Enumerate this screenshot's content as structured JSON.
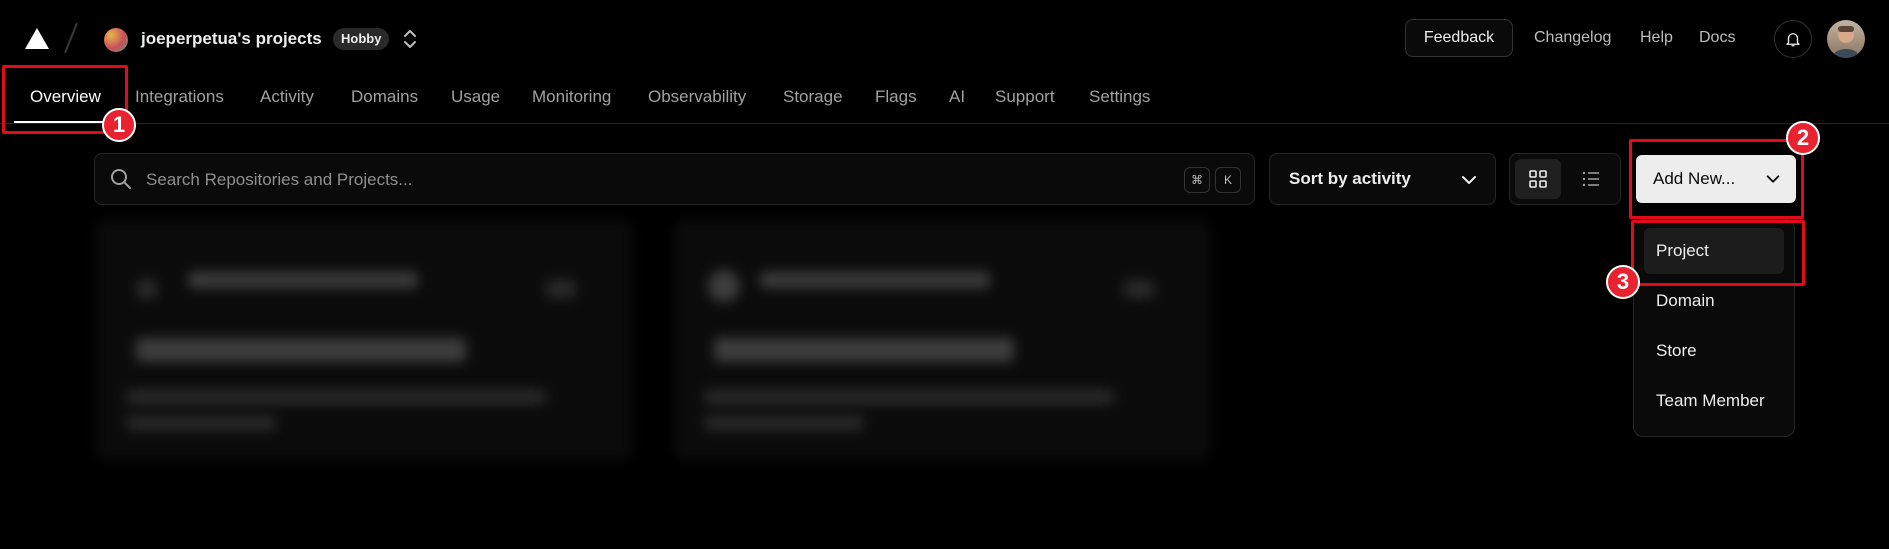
{
  "header": {
    "team_name": "joeperpetua's projects",
    "plan_badge": "Hobby",
    "feedback_label": "Feedback",
    "links": [
      "Changelog",
      "Help",
      "Docs"
    ]
  },
  "tabs": [
    "Overview",
    "Integrations",
    "Activity",
    "Domains",
    "Usage",
    "Monitoring",
    "Observability",
    "Storage",
    "Flags",
    "AI",
    "Support",
    "Settings"
  ],
  "active_tab": "Overview",
  "search": {
    "placeholder": "Search Repositories and Projects...",
    "value": "",
    "shortcut_keys": [
      "⌘",
      "K"
    ]
  },
  "sort": {
    "label": "Sort by activity"
  },
  "view": {
    "active": "grid"
  },
  "add_new": {
    "label": "Add New...",
    "menu_items": [
      "Project",
      "Domain",
      "Store",
      "Team Member"
    ],
    "highlighted_item": "Project"
  },
  "annotations": [
    "1",
    "2",
    "3"
  ],
  "colors": {
    "annotation": "#e00c1c",
    "background": "#000000",
    "primary_button": "#ededed"
  }
}
